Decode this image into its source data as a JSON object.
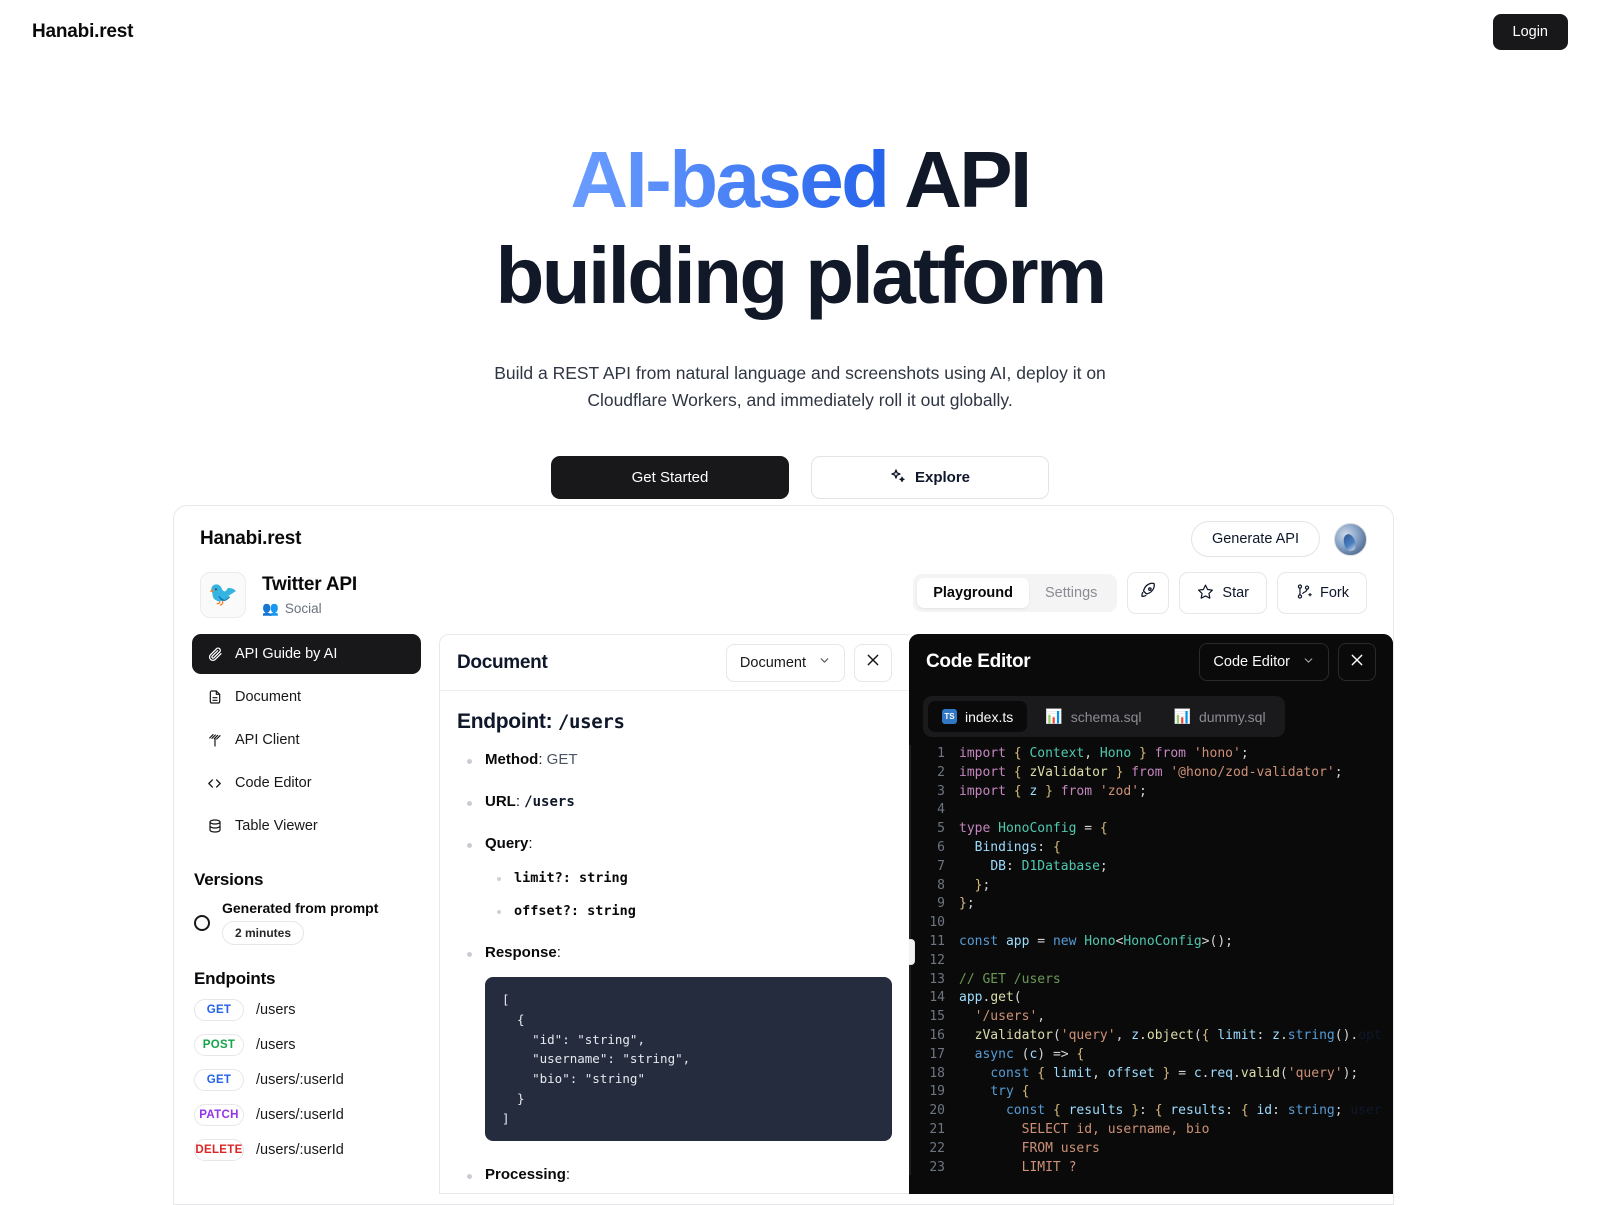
{
  "topnav": {
    "brand": "Hanabi.rest",
    "login_label": "Login"
  },
  "hero": {
    "title_accent": "AI-based",
    "title_rest": " API",
    "title_line2": "building platform",
    "subtitle": "Build a REST API from natural language and screenshots using AI, deploy it on Cloudflare Workers, and immediately roll it out globally.",
    "cta_primary": "Get Started",
    "cta_secondary": "Explore",
    "accent_from": "#6b9dff",
    "accent_to": "#2563eb"
  },
  "app": {
    "brand": "Hanabi.rest",
    "generate_label": "Generate API",
    "project": {
      "icon": "bird-emoji",
      "name": "Twitter API",
      "category": "Social",
      "category_icon": "people-emoji"
    },
    "tabs": [
      {
        "label": "Playground",
        "active": true
      },
      {
        "label": "Settings",
        "active": false
      }
    ],
    "actions": [
      {
        "label": "",
        "icon": "rocket-icon"
      },
      {
        "label": "Star",
        "icon": "star-icon"
      },
      {
        "label": "Fork",
        "icon": "fork-icon"
      }
    ],
    "sidebar": {
      "nav": [
        {
          "label": "API Guide by AI",
          "icon": "paperclip-icon",
          "active": true
        },
        {
          "label": "Document",
          "icon": "document-icon",
          "active": false
        },
        {
          "label": "API Client",
          "icon": "antenna-icon",
          "active": false
        },
        {
          "label": "Code Editor",
          "icon": "code-brackets-icon",
          "active": false
        },
        {
          "label": "Table Viewer",
          "icon": "database-icon",
          "active": false
        }
      ],
      "versions_heading": "Versions",
      "versions": [
        {
          "title": "Generated from prompt",
          "chip": "2 minutes"
        }
      ],
      "endpoints_heading": "Endpoints",
      "endpoints": [
        {
          "method": "GET",
          "path": "/users"
        },
        {
          "method": "POST",
          "path": "/users"
        },
        {
          "method": "GET",
          "path": "/users/:userId"
        },
        {
          "method": "PATCH",
          "path": "/users/:userId"
        },
        {
          "method": "DELETE",
          "path": "/users/:userId"
        }
      ]
    },
    "document_panel": {
      "title": "Document",
      "select_value": "Document",
      "close_icon": "close-icon",
      "endpoint_label": "Endpoint:",
      "endpoint_path": "/users",
      "method_label": "Method",
      "method_value": "GET",
      "url_label": "URL",
      "url_value": "/users",
      "query_label": "Query",
      "query_params": [
        "limit?: string",
        "offset?: string"
      ],
      "response_label": "Response",
      "response_code": "[\n  {\n    \"id\": \"string\",\n    \"username\": \"string\",\n    \"bio\": \"string\"\n  }\n]",
      "processing_label": "Processing"
    },
    "code_panel": {
      "title": "Code Editor",
      "select_value": "Code Editor",
      "close_icon": "close-icon",
      "files": [
        {
          "name": "index.ts",
          "icon": "typescript-icon",
          "active": true
        },
        {
          "name": "schema.sql",
          "icon": "database-emoji",
          "active": false
        },
        {
          "name": "dummy.sql",
          "icon": "database-emoji",
          "active": false
        }
      ],
      "first_line": 1,
      "last_line": 23,
      "code_lines": [
        "import { Context, Hono } from 'hono';",
        "import { zValidator } from '@hono/zod-validator';",
        "import { z } from 'zod';",
        "",
        "type HonoConfig = {",
        "  Bindings: {",
        "    DB: D1Database;",
        "  };",
        "};",
        "",
        "const app = new Hono<HonoConfig>();",
        "",
        "// GET /users",
        "app.get(",
        "  '/users',",
        "  zValidator('query', z.object({ limit: z.string().opt",
        "  async (c) => {",
        "    const { limit, offset } = c.req.valid('query');",
        "    try {",
        "      const { results }: { results: { id: string; user",
        "        SELECT id, username, bio",
        "        FROM users",
        "        LIMIT ?"
      ]
    }
  }
}
